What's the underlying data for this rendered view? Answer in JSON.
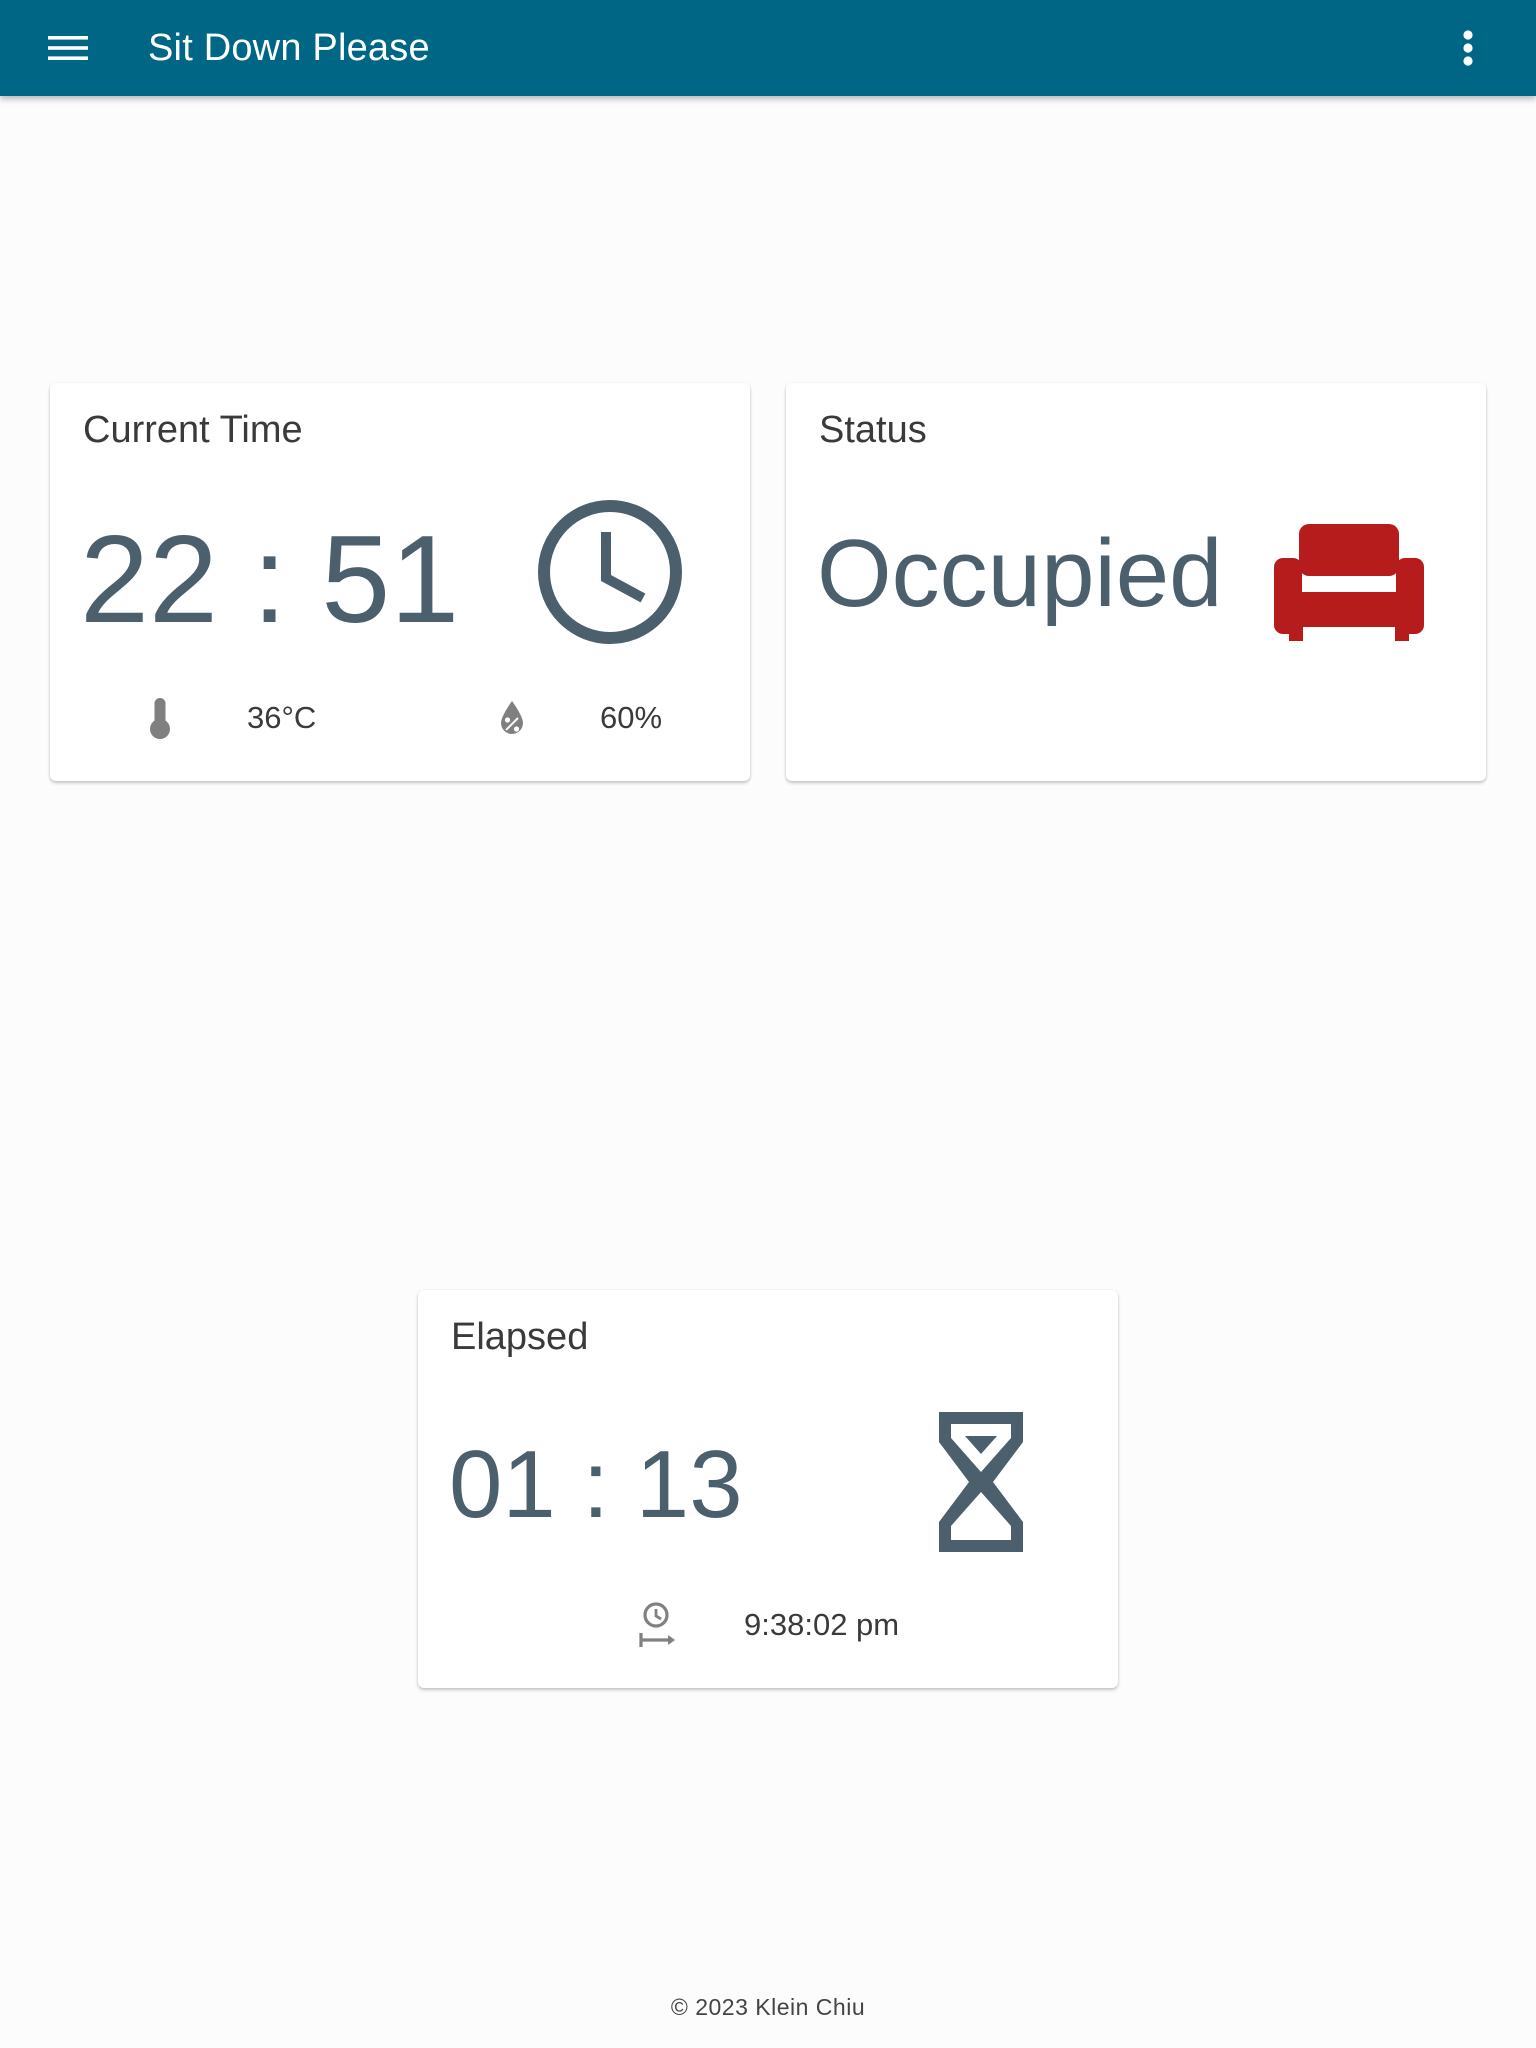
{
  "app": {
    "title": "Sit Down Please"
  },
  "current_time_card": {
    "title": "Current Time",
    "time": "22 : 51",
    "temperature": "36°C",
    "humidity": "60%"
  },
  "status_card": {
    "title": "Status",
    "status": "Occupied",
    "status_icon_color": "#b71c1c"
  },
  "elapsed_card": {
    "title": "Elapsed",
    "elapsed": "01 : 13",
    "start_time": "9:38:02 pm"
  },
  "footer": {
    "text": "© 2023 Klein Chiu"
  },
  "colors": {
    "appbar": "#006685",
    "value_text": "#4b5f6c",
    "icon_gray": "#808080"
  },
  "icons": [
    "menu-icon",
    "more-vert-icon",
    "clock-icon",
    "thermometer-icon",
    "humidity-icon",
    "sofa-icon",
    "hourglass-icon",
    "start-timer-icon"
  ]
}
